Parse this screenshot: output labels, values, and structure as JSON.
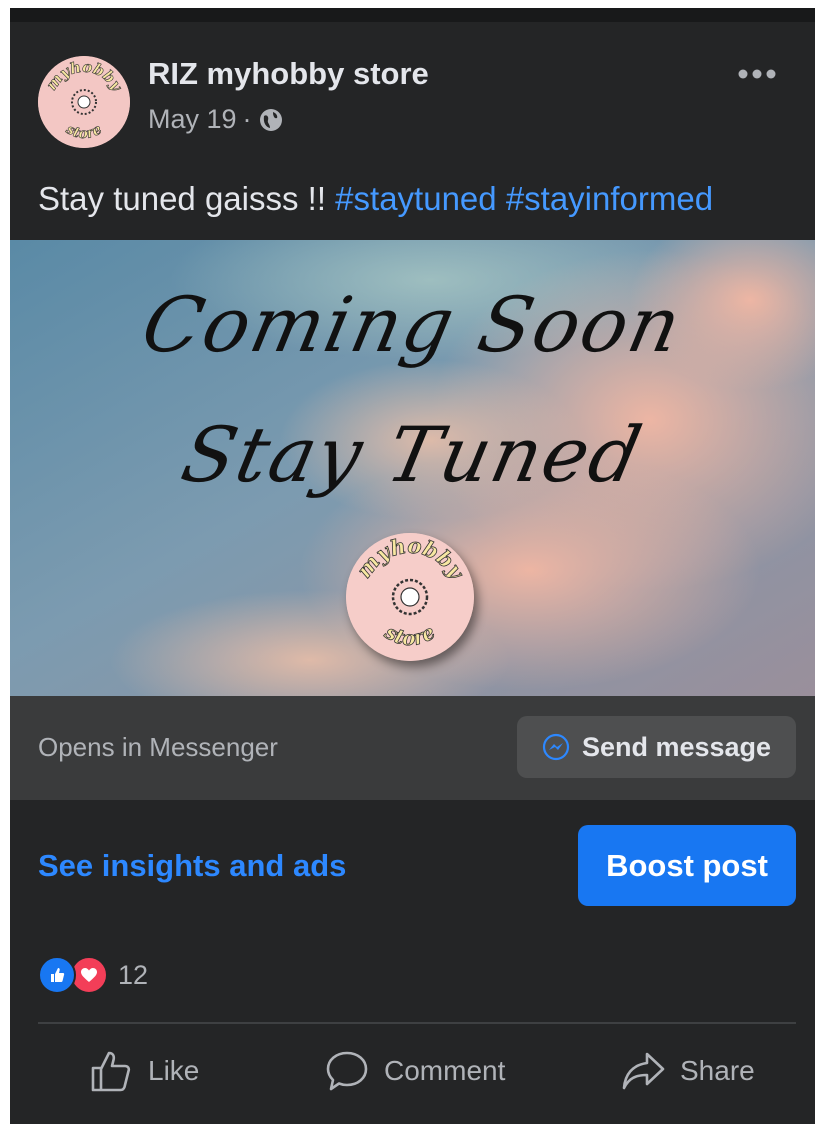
{
  "post": {
    "page_name": "RIZ myhobby store",
    "date": "May 19",
    "separator": "·",
    "caption_text": "Stay tuned gaisss !! ",
    "hashtags": [
      "#staytuned",
      "#stayinformed"
    ]
  },
  "image": {
    "line1": "Coming Soon",
    "line2": "Stay Tuned",
    "logo_top": "myhobby",
    "logo_bottom": "store"
  },
  "avatar": {
    "logo_top": "myhobby",
    "logo_bottom": "store"
  },
  "cta": {
    "opens_text": "Opens in Messenger",
    "send_label": "Send message"
  },
  "promo": {
    "insights_label": "See insights and ads",
    "boost_label": "Boost post"
  },
  "reactions": {
    "count": "12",
    "types": [
      "like",
      "love"
    ]
  },
  "actions": {
    "like": "Like",
    "comment": "Comment",
    "share": "Share"
  },
  "colors": {
    "background": "#242526",
    "link": "#2d88ff",
    "hashtag": "#4599ff",
    "boost": "#1877f2",
    "love": "#f33e58"
  },
  "icons": [
    "globe-icon",
    "more-options-icon",
    "messenger-icon",
    "like-reaction-icon",
    "love-reaction-icon",
    "thumbs-up-icon",
    "comment-icon",
    "share-icon"
  ]
}
